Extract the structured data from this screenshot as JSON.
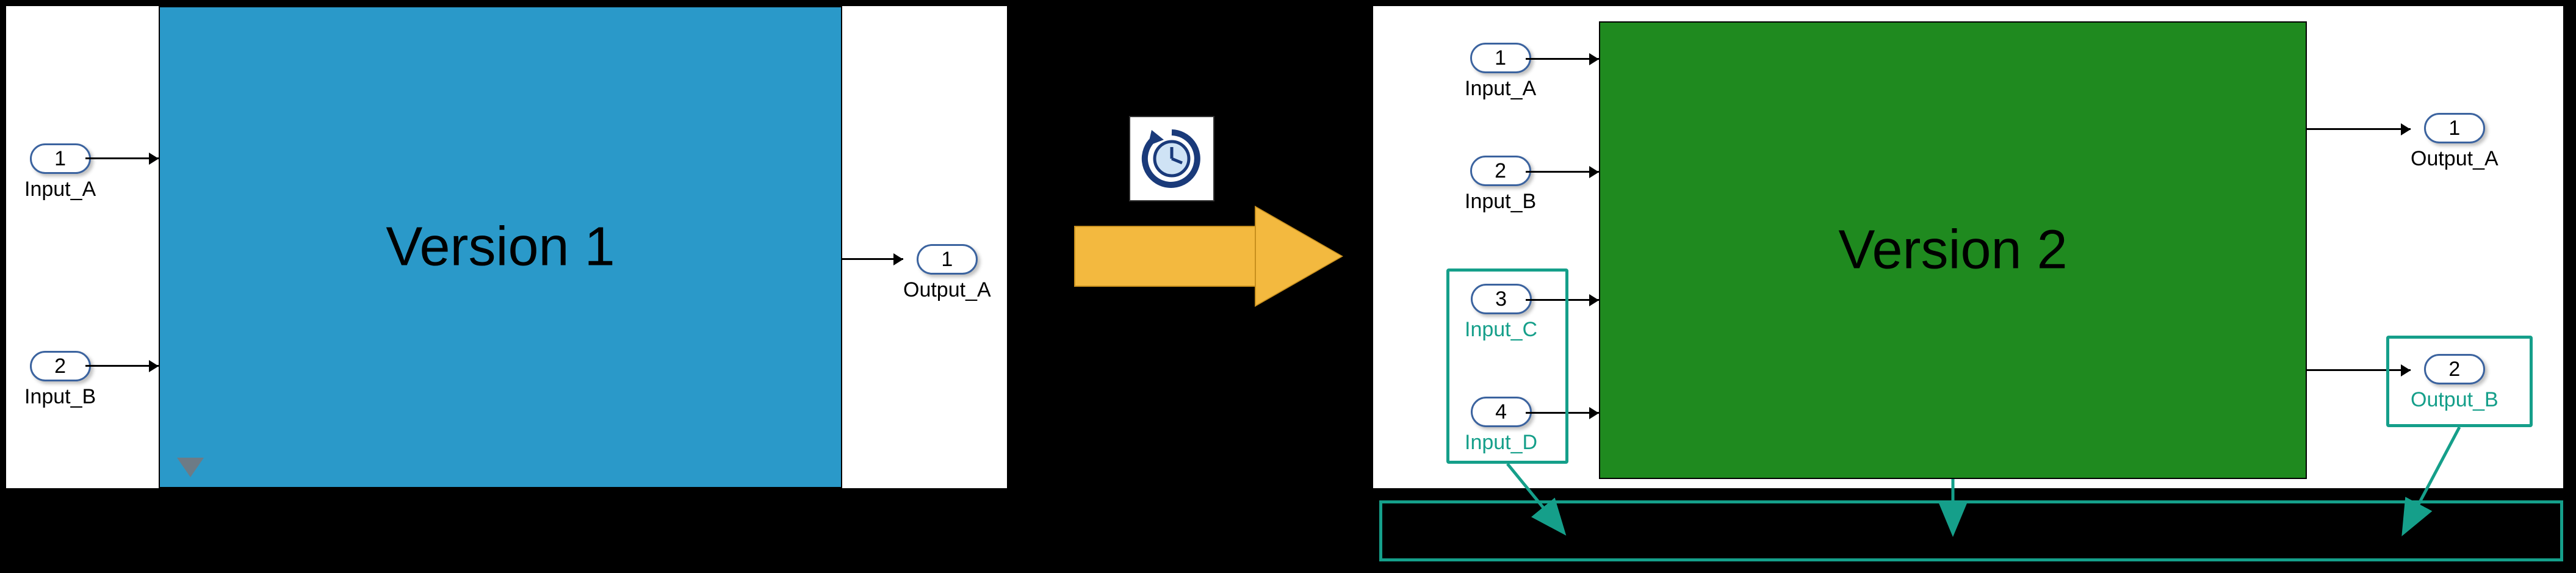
{
  "left": {
    "block_title": "Version 1",
    "inputs": [
      {
        "num": "1",
        "label": "Input_A"
      },
      {
        "num": "2",
        "label": "Input_B"
      }
    ],
    "outputs": [
      {
        "num": "1",
        "label": "Output_A"
      }
    ]
  },
  "right": {
    "block_title": "Version 2",
    "inputs": [
      {
        "num": "1",
        "label": "Input_A",
        "new": false
      },
      {
        "num": "2",
        "label": "Input_B",
        "new": false
      },
      {
        "num": "3",
        "label": "Input_C",
        "new": true
      },
      {
        "num": "4",
        "label": "Input_D",
        "new": true
      }
    ],
    "outputs": [
      {
        "num": "1",
        "label": "Output_A",
        "new": false
      },
      {
        "num": "2",
        "label": "Output_B",
        "new": true
      }
    ]
  },
  "icons": {
    "clock": "update-icon",
    "transition": "transition-arrow"
  },
  "colors": {
    "v1_block": "#2a99c9",
    "v2_block": "#1f8a1f",
    "highlight": "#159f8a",
    "arrow": "#f3b93f"
  }
}
